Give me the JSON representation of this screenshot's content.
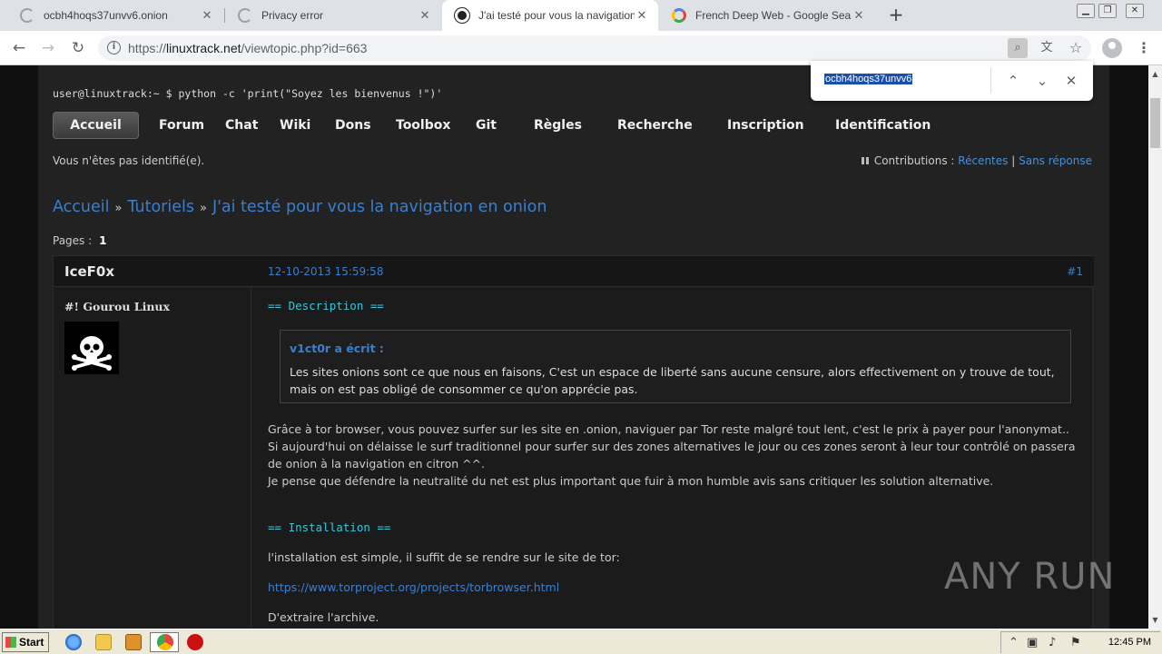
{
  "browser": {
    "tabs": [
      {
        "label": "ocbh4hoqs37unvv6.onion",
        "icon": "loading-spinner"
      },
      {
        "label": "Privacy error",
        "icon": "loading-spinner"
      },
      {
        "label": "J'ai testé pour vous la navigation en onion",
        "icon": "site-favicon"
      },
      {
        "label": "French Deep Web - Google Search",
        "icon": "google-icon"
      }
    ],
    "new_tab": "+",
    "url_scheme": "https://",
    "url_host": "linuxtrack.net",
    "url_path": "/viewtopic.php?id=663",
    "find": {
      "query": "ocbh4hoqs37unvv6"
    }
  },
  "forum": {
    "prompt": "user@linuxtrack:~ $ python -c 'print(\"Soyez les bienvenus !\")'",
    "menu": [
      "Accueil",
      "Forum",
      "Chat",
      "Wiki",
      "Dons",
      "Toolbox",
      "Git",
      "Règles",
      "Recherche",
      "Inscription",
      "Identification"
    ],
    "notice": "Vous n'êtes pas identifié(e).",
    "contrib_label": "Contributions :",
    "contrib_recent": "Récentes",
    "contrib_sep": "|",
    "contrib_unanswered": "Sans réponse",
    "breadcrumb": [
      "Accueil",
      "Tutoriels",
      "J'ai testé pour vous la navigation en onion"
    ],
    "breadcrumb_sep": "»",
    "pages_label": "Pages :",
    "pages_current": "1"
  },
  "post": {
    "author": "IceF0x",
    "date": "12-10-2013 15:59:58",
    "number": "#1",
    "rank": "#! Gourou Linux",
    "desc_heading": "== Description ==",
    "quote_author": "v1ct0r a écrit :",
    "quote_text": "Les sites onions sont ce que nous en faisons, C'est un espace de liberté sans aucune censure, alors effectivement on y trouve de tout, mais on est pas obligé de consommer ce qu'on apprécie pas.",
    "para1": "Grâce à tor browser, vous pouvez surfer sur les site en .onion, naviguer par Tor reste malgré tout lent, c'est le prix à payer pour l'anonymat..",
    "para2": "Si aujourd'hui on délaisse le surf traditionnel pour surfer sur des zones alternatives le jour ou ces zones seront à leur tour contrôlé on passera de onion à la navigation en citron ^^.",
    "para3": "Je pense que défendre la neutralité du net est plus important que fuir à mon humble avis sans critiquer les solution alternative.",
    "install_heading": "== Installation ==",
    "install_text": "l'installation est simple, il suffit de se rendre sur le site de tor:",
    "install_link": "https://www.torproject.org/projects/torbrowser.html",
    "extract_text": "D'extraire l'archive."
  },
  "watermark": "ANY RUN",
  "taskbar": {
    "start": "Start",
    "clock": "12:45 PM"
  },
  "colors": {
    "link": "#3a7fcf",
    "heading_cyan": "#37c7d9",
    "page_bg": "#222222"
  }
}
